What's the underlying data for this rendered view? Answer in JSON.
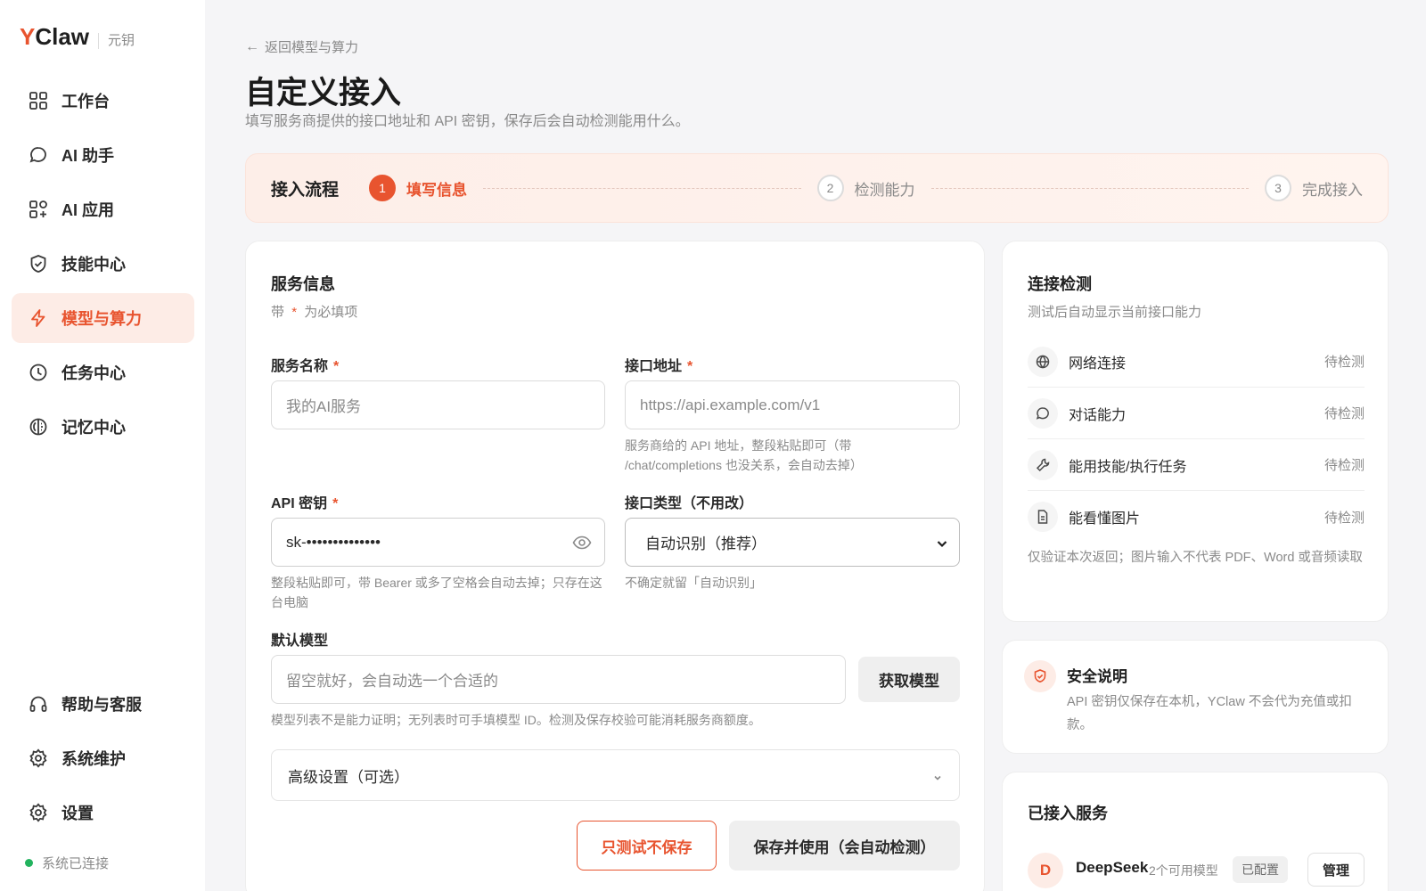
{
  "brand": {
    "logo_y": "Y",
    "logo_rest": "Claw",
    "sub": "元钥"
  },
  "sidebar": {
    "items": [
      {
        "label": "工作台",
        "icon": "grid-icon"
      },
      {
        "label": "AI 助手",
        "icon": "chat-icon"
      },
      {
        "label": "AI 应用",
        "icon": "apps-icon"
      },
      {
        "label": "技能中心",
        "icon": "shield-icon"
      },
      {
        "label": "模型与算力",
        "icon": "bolt-icon",
        "active": true
      },
      {
        "label": "任务中心",
        "icon": "clock-icon"
      },
      {
        "label": "记忆中心",
        "icon": "memory-icon"
      }
    ],
    "bottom_items": [
      {
        "label": "帮助与客服",
        "icon": "headset-icon"
      },
      {
        "label": "系统维护",
        "icon": "gear-icon"
      },
      {
        "label": "设置",
        "icon": "gear-icon"
      }
    ],
    "status": "系统已连接"
  },
  "header": {
    "back": "返回模型与算力",
    "title": "自定义接入",
    "description": "填写服务商提供的接口地址和 API 密钥，保存后会自动检测能用什么。"
  },
  "steps": {
    "title": "接入流程",
    "items": [
      {
        "num": "1",
        "label": "填写信息",
        "active": true
      },
      {
        "num": "2",
        "label": "检测能力"
      },
      {
        "num": "3",
        "label": "完成接入"
      }
    ]
  },
  "form": {
    "title": "服务信息",
    "required_prefix": "带",
    "required_star": "*",
    "required_suffix": "为必填项",
    "service_name": {
      "label": "服务名称",
      "placeholder": "我的AI服务"
    },
    "endpoint": {
      "label": "接口地址",
      "placeholder": "https://api.example.com/v1",
      "hint": "服务商给的 API 地址，整段粘贴即可（带 /chat/completions 也没关系，会自动去掉）"
    },
    "api_key": {
      "label": "API 密钥",
      "value": "sk-••••••••••••••",
      "hint": "整段粘贴即可，带 Bearer 或多了空格会自动去掉；只存在这台电脑"
    },
    "api_type": {
      "label": "接口类型（不用改）",
      "value": "自动识别（推荐）",
      "hint": "不确定就留「自动识别」"
    },
    "default_model": {
      "label": "默认模型",
      "placeholder": "留空就好，会自动选一个合适的",
      "fetch_button": "获取模型",
      "hint": "模型列表不是能力证明；无列表时可手填模型 ID。检测及保存校验可能消耗服务商额度。"
    },
    "advanced": "高级设置（可选）",
    "test_button": "只测试不保存",
    "save_button": "保存并使用（会自动检测）"
  },
  "check": {
    "title": "连接检测",
    "subtitle": "测试后自动显示当前接口能力",
    "items": [
      {
        "name": "网络连接",
        "status": "待检测",
        "icon": "globe-icon"
      },
      {
        "name": "对话能力",
        "status": "待检测",
        "icon": "chat-icon"
      },
      {
        "name": "能用技能/执行任务",
        "status": "待检测",
        "icon": "wrench-icon"
      },
      {
        "name": "能看懂图片",
        "status": "待检测",
        "icon": "document-icon"
      }
    ],
    "note": "仅验证本次返回；图片输入不代表 PDF、Word 或音频读取"
  },
  "safety": {
    "title": "安全说明",
    "text": "API 密钥仅保存在本机，YClaw 不会代为充值或扣款。"
  },
  "services": {
    "title": "已接入服务",
    "items": [
      {
        "avatar": "D",
        "name": "DeepSeek",
        "models": "2个可用模型",
        "badge": "已配置",
        "manage": "管理"
      }
    ]
  },
  "colors": {
    "accent": "#e8542f",
    "status_ok": "#22b35e"
  }
}
